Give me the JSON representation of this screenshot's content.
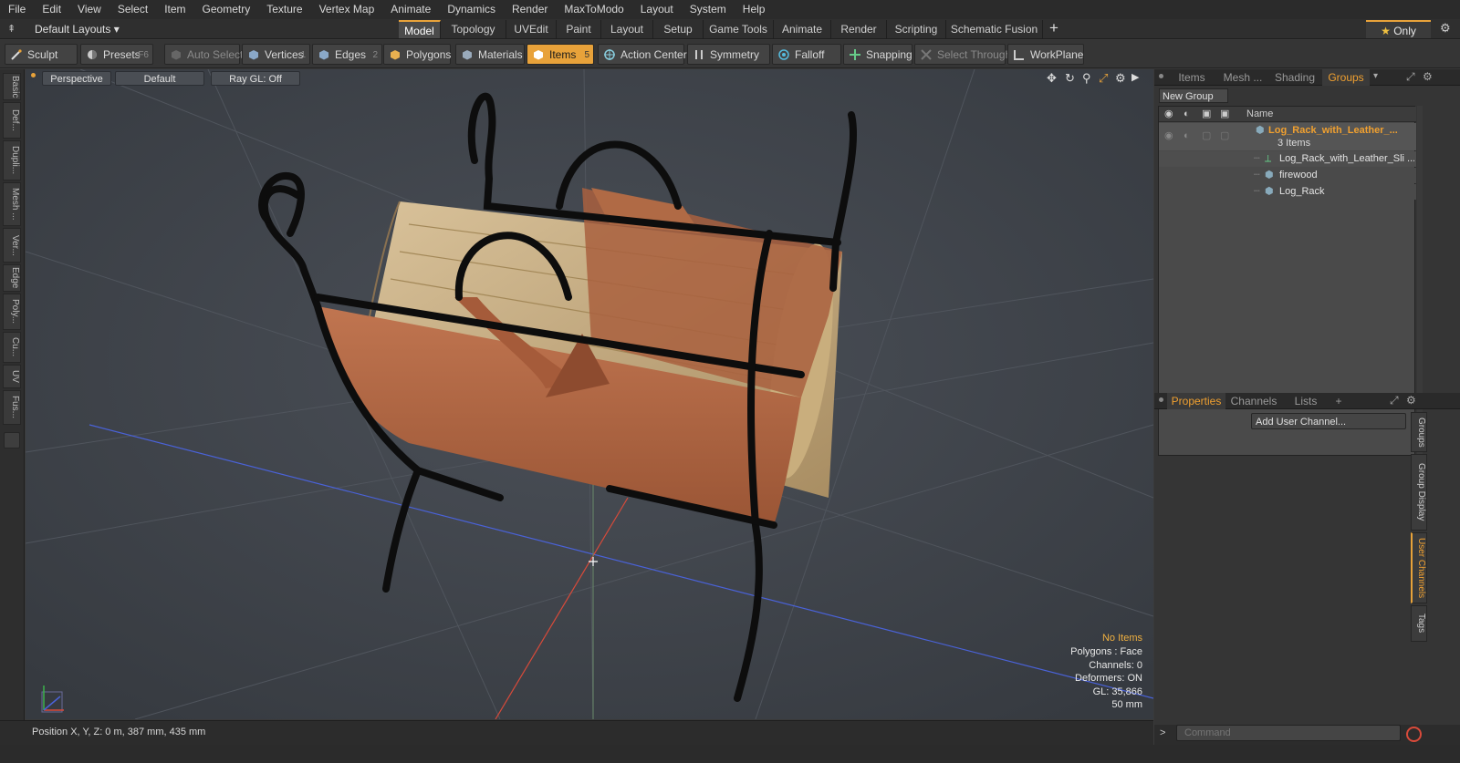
{
  "menu": [
    "File",
    "Edit",
    "View",
    "Select",
    "Item",
    "Geometry",
    "Texture",
    "Vertex Map",
    "Animate",
    "Dynamics",
    "Render",
    "MaxToModo",
    "Layout",
    "System",
    "Help"
  ],
  "layout_selector": "Default Layouts ▾",
  "layout_tabs": [
    {
      "label": "Model",
      "active": true
    },
    {
      "label": "Topology",
      "active": false
    },
    {
      "label": "UVEdit",
      "active": false
    },
    {
      "label": "Paint",
      "active": false
    },
    {
      "label": "Layout",
      "active": false
    },
    {
      "label": "Setup",
      "active": false
    },
    {
      "label": "Game Tools",
      "active": false
    },
    {
      "label": "Animate",
      "active": false
    },
    {
      "label": "Render",
      "active": false
    },
    {
      "label": "Scripting",
      "active": false
    },
    {
      "label": "Schematic Fusion",
      "active": false
    }
  ],
  "add_tab": "+",
  "only_button": "Only",
  "toolbar": {
    "sculpt": "Sculpt",
    "presets": "Presets",
    "presets_key": "F6",
    "auto_select": "Auto Select",
    "vertices": "Vertices",
    "vertices_key": "1",
    "edges": "Edges",
    "edges_key": "2",
    "polygons": "Polygons",
    "materials": "Materials",
    "items": "Items",
    "items_key": "5",
    "action_center": "Action Center",
    "symmetry": "Symmetry",
    "falloff": "Falloff",
    "snapping": "Snapping",
    "select_through": "Select Through",
    "workplane": "WorkPlane"
  },
  "left_tabs": [
    "Basic",
    "Def...",
    "Dupli...",
    "Mesh ...",
    "Ver...",
    "Edge",
    "Poly...",
    "Cu...",
    "UV",
    "Fus..."
  ],
  "viewport": {
    "view": "Perspective",
    "style": "Default",
    "raygl": "Ray GL: Off",
    "info": {
      "items": "No Items",
      "polygons": "Polygons : Face",
      "channels": "Channels: 0",
      "deformers": "Deformers: ON",
      "gl": "GL: 35,866",
      "units": "50 mm"
    }
  },
  "status": {
    "position": "Position X, Y, Z:   0 m, 387 mm, 435 mm"
  },
  "right_top_tabs": [
    {
      "label": "Items",
      "active": false
    },
    {
      "label": "Mesh ...",
      "active": false
    },
    {
      "label": "Shading",
      "active": false
    },
    {
      "label": "Groups",
      "active": true
    }
  ],
  "groups": {
    "new_group": "New Group",
    "col_name": "Name",
    "root": "Log_Rack_with_Leather_...",
    "root_count": "3 Items",
    "children": [
      "Log_Rack_with_Leather_Sli ...",
      "firewood",
      "Log_Rack"
    ]
  },
  "right_bottom_tabs": [
    {
      "label": "Properties",
      "active": true
    },
    {
      "label": "Channels",
      "active": false
    },
    {
      "label": "Lists",
      "active": false
    },
    {
      "label": "+",
      "active": false
    }
  ],
  "add_user_channel": "Add User Channel...",
  "right_vtabs": [
    {
      "label": "Groups",
      "active": false
    },
    {
      "label": "Group Display",
      "active": false
    },
    {
      "label": "User Channels",
      "active": true
    },
    {
      "label": "Tags",
      "active": false
    }
  ],
  "command_placeholder": "Command",
  "colors": {
    "accent": "#e8a23a",
    "leather": "#b86a45",
    "wood": "#c9b08a",
    "iron": "#0d0d0d"
  }
}
